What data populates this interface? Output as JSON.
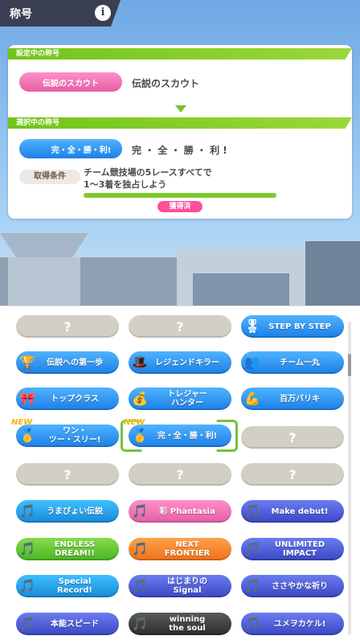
{
  "header": {
    "title": "称号",
    "info_icon": "i"
  },
  "current": {
    "section_label": "設定中の称号",
    "badge_label": "伝説のスカウト",
    "title": "伝説のスカウト"
  },
  "selected": {
    "section_label": "選択中の称号",
    "badge_label": "完・全・勝・利!",
    "title": "完 ・ 全 ・ 勝 ・ 利 !",
    "condition_label": "取得条件",
    "condition_text_1": "チーム競技場の5レースすべてで",
    "condition_text_2": "1～3着を独占しよう",
    "progress": 1.0,
    "status": "獲得済"
  },
  "titles": {
    "unknown": "?",
    "new": "NEW",
    "items": [
      "STEP BY STEP",
      "伝説への第一歩",
      "レジェンドキラー",
      "チーム一丸",
      "トップクラス",
      "トレジャー\nハンター",
      "百万バリキ",
      "ワン・\nツー・スリー!",
      "完・全・勝・利!",
      "うまぴょい伝説",
      "彩 Phantasia",
      "Make debut!",
      "ENDLESS\nDREAM!!",
      "NEXT\nFRONTIER",
      "UNLIMITED\nIMPACT",
      "Special\nRecord!",
      "はじまりの\nSignal",
      "ささやかな祈り",
      "本能スピード",
      "winning\nthe soul",
      "ユメヲカケル!"
    ]
  }
}
